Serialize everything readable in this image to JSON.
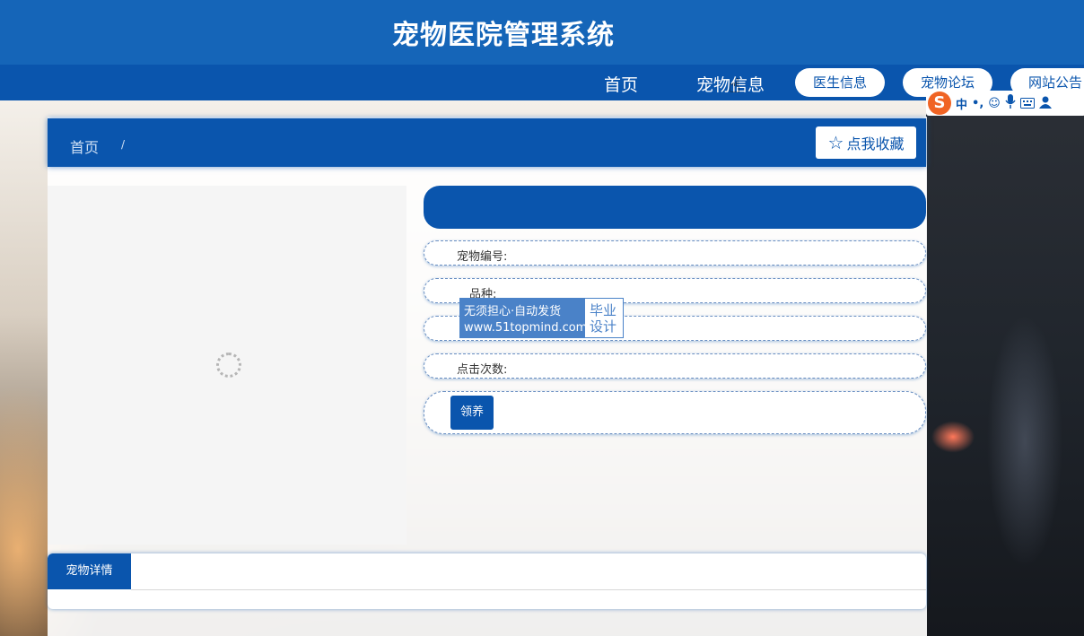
{
  "header": {
    "title": "宠物医院管理系统"
  },
  "nav": {
    "items": [
      {
        "label": "首页"
      },
      {
        "label": "宠物信息"
      },
      {
        "label": "医生信息"
      },
      {
        "label": "宠物论坛"
      },
      {
        "label": "网站公告"
      }
    ]
  },
  "ime": {
    "logo": "S",
    "items": [
      "中",
      "•,",
      "☺",
      "mic-icon",
      "keyboard-icon",
      "user-icon"
    ],
    "mode": "中",
    "punct": "•,"
  },
  "breadcrumb": {
    "home": "首页",
    "separator": "/"
  },
  "favorite": {
    "label": "点我收藏",
    "icon": "star-icon"
  },
  "detail": {
    "pet_number_label": "宠物编号:",
    "breed_label": "品种:",
    "clicks_label": "点击次数:",
    "adopt_button": "领养"
  },
  "watermark": {
    "line1": "无须担心·自动发货",
    "line2": "www.51topmind.com",
    "right1": "毕业",
    "right2": "设计"
  },
  "tabs": {
    "details": "宠物详情"
  },
  "colors": {
    "primary": "#0a55ad",
    "header": "#1565b8"
  }
}
